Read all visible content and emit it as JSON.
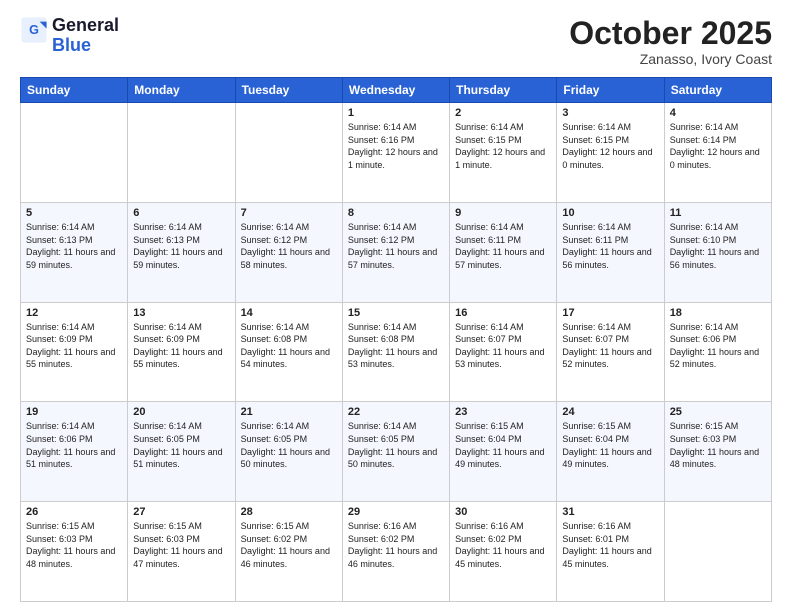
{
  "header": {
    "logo_line1": "General",
    "logo_line2": "Blue",
    "month": "October 2025",
    "location": "Zanasso, Ivory Coast"
  },
  "weekdays": [
    "Sunday",
    "Monday",
    "Tuesday",
    "Wednesday",
    "Thursday",
    "Friday",
    "Saturday"
  ],
  "weeks": [
    [
      {
        "day": "",
        "info": ""
      },
      {
        "day": "",
        "info": ""
      },
      {
        "day": "",
        "info": ""
      },
      {
        "day": "1",
        "info": "Sunrise: 6:14 AM\nSunset: 6:16 PM\nDaylight: 12 hours and 1 minute."
      },
      {
        "day": "2",
        "info": "Sunrise: 6:14 AM\nSunset: 6:15 PM\nDaylight: 12 hours and 1 minute."
      },
      {
        "day": "3",
        "info": "Sunrise: 6:14 AM\nSunset: 6:15 PM\nDaylight: 12 hours and 0 minutes."
      },
      {
        "day": "4",
        "info": "Sunrise: 6:14 AM\nSunset: 6:14 PM\nDaylight: 12 hours and 0 minutes."
      }
    ],
    [
      {
        "day": "5",
        "info": "Sunrise: 6:14 AM\nSunset: 6:13 PM\nDaylight: 11 hours and 59 minutes."
      },
      {
        "day": "6",
        "info": "Sunrise: 6:14 AM\nSunset: 6:13 PM\nDaylight: 11 hours and 59 minutes."
      },
      {
        "day": "7",
        "info": "Sunrise: 6:14 AM\nSunset: 6:12 PM\nDaylight: 11 hours and 58 minutes."
      },
      {
        "day": "8",
        "info": "Sunrise: 6:14 AM\nSunset: 6:12 PM\nDaylight: 11 hours and 57 minutes."
      },
      {
        "day": "9",
        "info": "Sunrise: 6:14 AM\nSunset: 6:11 PM\nDaylight: 11 hours and 57 minutes."
      },
      {
        "day": "10",
        "info": "Sunrise: 6:14 AM\nSunset: 6:11 PM\nDaylight: 11 hours and 56 minutes."
      },
      {
        "day": "11",
        "info": "Sunrise: 6:14 AM\nSunset: 6:10 PM\nDaylight: 11 hours and 56 minutes."
      }
    ],
    [
      {
        "day": "12",
        "info": "Sunrise: 6:14 AM\nSunset: 6:09 PM\nDaylight: 11 hours and 55 minutes."
      },
      {
        "day": "13",
        "info": "Sunrise: 6:14 AM\nSunset: 6:09 PM\nDaylight: 11 hours and 55 minutes."
      },
      {
        "day": "14",
        "info": "Sunrise: 6:14 AM\nSunset: 6:08 PM\nDaylight: 11 hours and 54 minutes."
      },
      {
        "day": "15",
        "info": "Sunrise: 6:14 AM\nSunset: 6:08 PM\nDaylight: 11 hours and 53 minutes."
      },
      {
        "day": "16",
        "info": "Sunrise: 6:14 AM\nSunset: 6:07 PM\nDaylight: 11 hours and 53 minutes."
      },
      {
        "day": "17",
        "info": "Sunrise: 6:14 AM\nSunset: 6:07 PM\nDaylight: 11 hours and 52 minutes."
      },
      {
        "day": "18",
        "info": "Sunrise: 6:14 AM\nSunset: 6:06 PM\nDaylight: 11 hours and 52 minutes."
      }
    ],
    [
      {
        "day": "19",
        "info": "Sunrise: 6:14 AM\nSunset: 6:06 PM\nDaylight: 11 hours and 51 minutes."
      },
      {
        "day": "20",
        "info": "Sunrise: 6:14 AM\nSunset: 6:05 PM\nDaylight: 11 hours and 51 minutes."
      },
      {
        "day": "21",
        "info": "Sunrise: 6:14 AM\nSunset: 6:05 PM\nDaylight: 11 hours and 50 minutes."
      },
      {
        "day": "22",
        "info": "Sunrise: 6:14 AM\nSunset: 6:05 PM\nDaylight: 11 hours and 50 minutes."
      },
      {
        "day": "23",
        "info": "Sunrise: 6:15 AM\nSunset: 6:04 PM\nDaylight: 11 hours and 49 minutes."
      },
      {
        "day": "24",
        "info": "Sunrise: 6:15 AM\nSunset: 6:04 PM\nDaylight: 11 hours and 49 minutes."
      },
      {
        "day": "25",
        "info": "Sunrise: 6:15 AM\nSunset: 6:03 PM\nDaylight: 11 hours and 48 minutes."
      }
    ],
    [
      {
        "day": "26",
        "info": "Sunrise: 6:15 AM\nSunset: 6:03 PM\nDaylight: 11 hours and 48 minutes."
      },
      {
        "day": "27",
        "info": "Sunrise: 6:15 AM\nSunset: 6:03 PM\nDaylight: 11 hours and 47 minutes."
      },
      {
        "day": "28",
        "info": "Sunrise: 6:15 AM\nSunset: 6:02 PM\nDaylight: 11 hours and 46 minutes."
      },
      {
        "day": "29",
        "info": "Sunrise: 6:16 AM\nSunset: 6:02 PM\nDaylight: 11 hours and 46 minutes."
      },
      {
        "day": "30",
        "info": "Sunrise: 6:16 AM\nSunset: 6:02 PM\nDaylight: 11 hours and 45 minutes."
      },
      {
        "day": "31",
        "info": "Sunrise: 6:16 AM\nSunset: 6:01 PM\nDaylight: 11 hours and 45 minutes."
      },
      {
        "day": "",
        "info": ""
      }
    ]
  ]
}
